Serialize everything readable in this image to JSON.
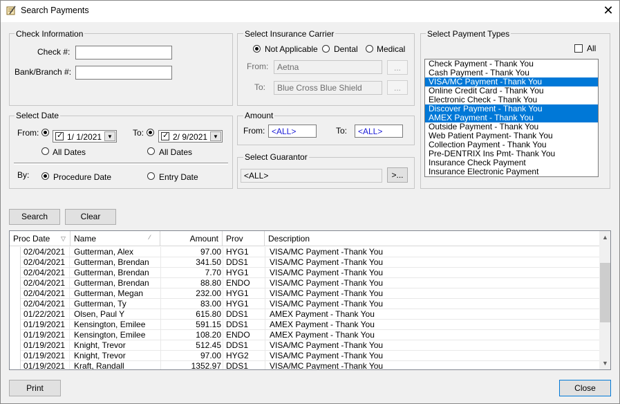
{
  "window": {
    "title": "Search Payments"
  },
  "check_info": {
    "group_label": "Check Information",
    "check_label": "Check #:",
    "check_value": "",
    "bank_label": "Bank/Branch #:",
    "bank_value": ""
  },
  "insurance": {
    "group_label": "Select Insurance Carrier",
    "options": [
      "Not Applicable",
      "Dental",
      "Medical"
    ],
    "selected": "Not Applicable",
    "from_label": "From:",
    "from_value": "Aetna",
    "to_label": "To:",
    "to_value": "Blue Cross Blue Shield",
    "browse_label": "..."
  },
  "payment_types": {
    "group_label": "Select Payment Types",
    "all_label": "All",
    "items": [
      {
        "label": "Check Payment - Thank You",
        "selected": false
      },
      {
        "label": "Cash Payment - Thank You",
        "selected": false
      },
      {
        "label": "VISA/MC Payment -Thank You",
        "selected": true
      },
      {
        "label": "Online Credit Card - Thank You",
        "selected": false
      },
      {
        "label": "Electronic Check - Thank You",
        "selected": false
      },
      {
        "label": "Discover Payment - Thank You",
        "selected": true
      },
      {
        "label": "AMEX Payment - Thank You",
        "selected": true
      },
      {
        "label": "Outside Payment - Thank You",
        "selected": false
      },
      {
        "label": "Web Patient Payment- Thank You",
        "selected": false
      },
      {
        "label": "Collection Payment - Thank You",
        "selected": false
      },
      {
        "label": "Pre-DENTRIX Ins Pmt- Thank You",
        "selected": false
      },
      {
        "label": "Insurance Check Payment",
        "selected": false
      },
      {
        "label": "Insurance Electronic Payment",
        "selected": false
      }
    ]
  },
  "date": {
    "group_label": "Select Date",
    "from_label": "From:",
    "from_value": "1/  1/2021",
    "to_label": "To:",
    "to_value": "2/  9/2021",
    "all_dates_label": "All Dates",
    "by_label": "By:",
    "procedure_date_label": "Procedure Date",
    "entry_date_label": "Entry Date"
  },
  "amount": {
    "group_label": "Amount",
    "from_label": "From:",
    "from_value": "<ALL>",
    "to_label": "To:",
    "to_value": "<ALL>"
  },
  "guarantor": {
    "group_label": "Select Guarantor",
    "value": "<ALL>",
    "browse_label": ">..."
  },
  "buttons": {
    "search": "Search",
    "clear": "Clear",
    "print": "Print",
    "close": "Close"
  },
  "grid": {
    "columns": [
      "Proc Date",
      "Name",
      "Amount",
      "Prov",
      "Description"
    ],
    "rows": [
      [
        "02/04/2021",
        "Gutterman, Alex",
        "97.00",
        "HYG1",
        "VISA/MC Payment -Thank You"
      ],
      [
        "02/04/2021",
        "Gutterman, Brendan",
        "341.50",
        "DDS1",
        "VISA/MC Payment -Thank You"
      ],
      [
        "02/04/2021",
        "Gutterman, Brendan",
        "7.70",
        "HYG1",
        "VISA/MC Payment -Thank You"
      ],
      [
        "02/04/2021",
        "Gutterman, Brendan",
        "88.80",
        "ENDO",
        "VISA/MC Payment -Thank You"
      ],
      [
        "02/04/2021",
        "Gutterman, Megan",
        "232.00",
        "HYG1",
        "VISA/MC Payment -Thank You"
      ],
      [
        "02/04/2021",
        "Gutterman, Ty",
        "83.00",
        "HYG1",
        "VISA/MC Payment -Thank You"
      ],
      [
        "01/22/2021",
        "Olsen, Paul Y",
        "615.80",
        "DDS1",
        "AMEX Payment - Thank You"
      ],
      [
        "01/19/2021",
        "Kensington, Emilee",
        "591.15",
        "DDS1",
        "AMEX Payment - Thank You"
      ],
      [
        "01/19/2021",
        "Kensington, Emilee",
        "108.20",
        "ENDO",
        "AMEX Payment - Thank You"
      ],
      [
        "01/19/2021",
        "Knight, Trevor",
        "512.45",
        "DDS1",
        "VISA/MC Payment -Thank You"
      ],
      [
        "01/19/2021",
        "Knight, Trevor",
        "97.00",
        "HYG2",
        "VISA/MC Payment -Thank You"
      ],
      [
        "01/19/2021",
        "Kraft, Randall",
        "1352.97",
        "DDS1",
        "VISA/MC Payment -Thank You"
      ]
    ]
  }
}
